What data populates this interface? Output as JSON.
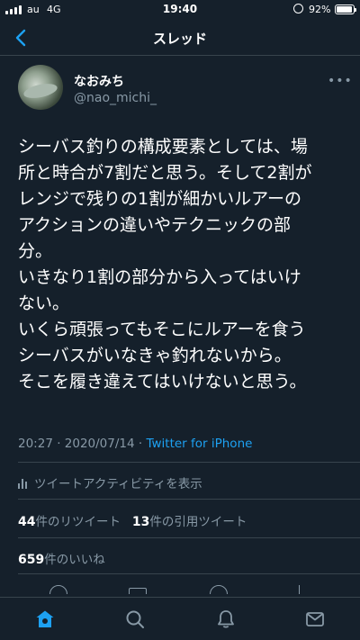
{
  "status_bar": {
    "carrier": "au",
    "network": "4G",
    "time": "19:40",
    "battery_percent": "92%",
    "battery_level": 0.92
  },
  "nav": {
    "title": "スレッド"
  },
  "tweet": {
    "display_name": "なおみち",
    "handle": "@nao_michi_",
    "lines": [
      "シーバス釣りの構成要素としては、場",
      "所と時合が7割だと思う。そして2割が",
      "レンジで残りの1割が細かいルアーの",
      "アクションの違いやテクニックの部",
      "分。",
      "いきなり1割の部分から入ってはいけ",
      "ない。",
      "いくら頑張ってもそこにルアーを食う",
      "シーバスがいなきゃ釣れないから。",
      "そこを履き違えてはいけないと思う。"
    ],
    "timestamp": "20:27 · 2020/07/14 · ",
    "source": "Twitter for iPhone",
    "activity_label": "ツイートアクティビティを表示",
    "retweet_count": "44",
    "retweet_label": "件のリツイート",
    "quote_count": "13",
    "quote_label": "件の引用ツイート",
    "like_count": "659",
    "like_label": "件のいいね"
  },
  "tabs": [
    "home",
    "search",
    "notifications",
    "messages"
  ],
  "colors": {
    "background": "#15202b",
    "secondary_text": "#8899a6",
    "accent": "#1da1f2",
    "divider": "#38444d"
  }
}
